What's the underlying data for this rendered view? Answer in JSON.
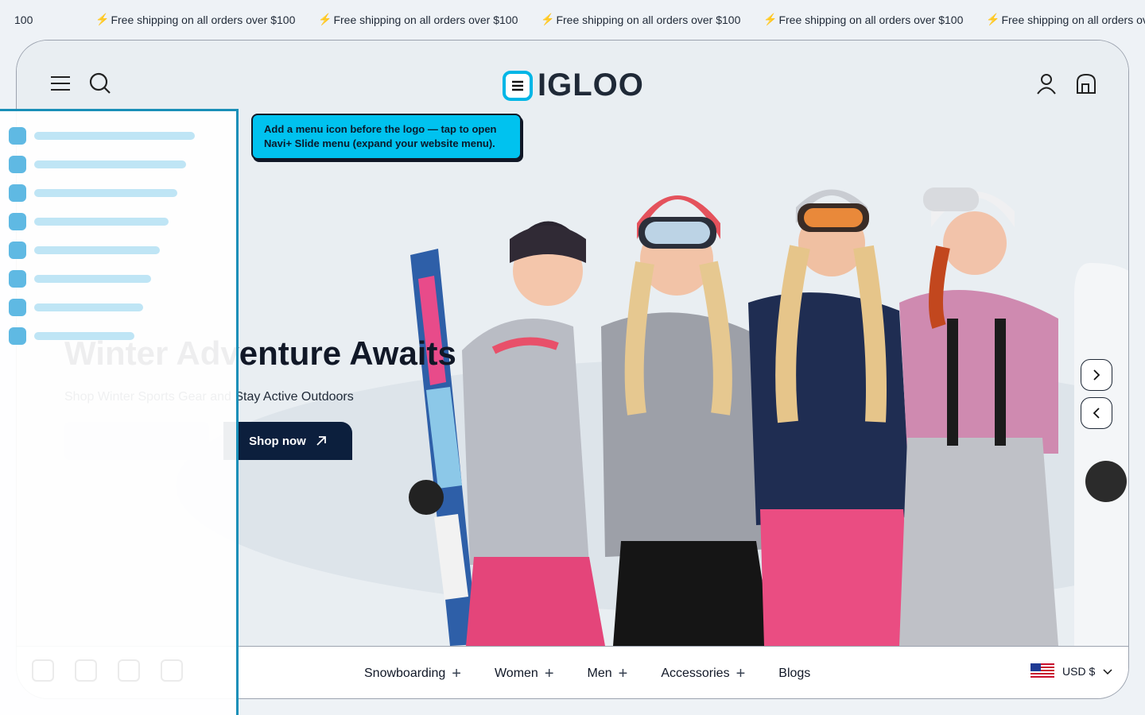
{
  "announcement": {
    "partial_left": "100",
    "message": "Free shipping on all orders over $100",
    "bolt_icon": "lightning-icon"
  },
  "header": {
    "logo_text": "IGLOO",
    "icons": [
      "hamburger-menu-icon",
      "search-icon",
      "account-icon",
      "cart-icon"
    ],
    "accent_color": "#00b6e6"
  },
  "hero": {
    "title": "Winter Adventure Awaits",
    "subtitle": "Shop Winter Sports Gear and Stay Active Outdoors",
    "cta_label": "Shop now",
    "next_icon": "chevron-right-icon",
    "prev_icon": "chevron-left-icon"
  },
  "tooltip": {
    "text": "Add a menu icon before the logo — tap to open Navi+ Slide menu (expand your website menu)."
  },
  "nav": {
    "items": [
      {
        "label": "Snowboarding",
        "expandable": true
      },
      {
        "label": "Women",
        "expandable": true
      },
      {
        "label": "Men",
        "expandable": true
      },
      {
        "label": "Accessories",
        "expandable": true
      },
      {
        "label": "Blogs",
        "expandable": false
      }
    ],
    "currency": "USD $",
    "flag": "us-flag-icon"
  },
  "colors": {
    "drawer_border": "#1a8fb8",
    "tooltip_bg": "#00c2ef",
    "cta_bg": "#0c1f3d"
  }
}
